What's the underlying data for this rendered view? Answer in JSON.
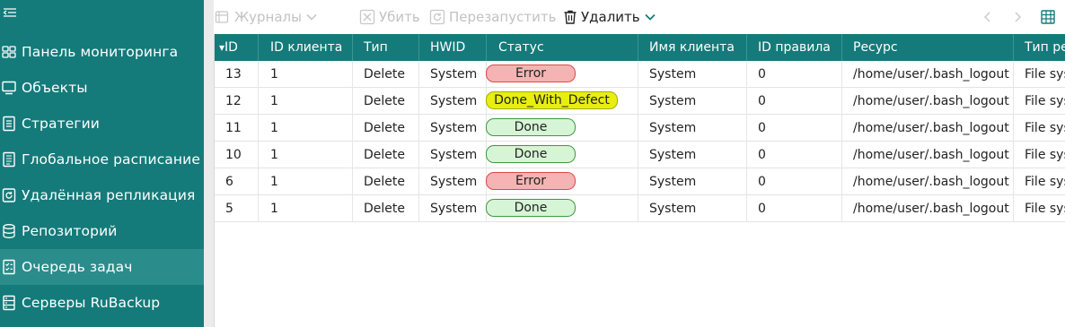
{
  "sidebar": {
    "items": [
      {
        "label": "Панель мониторинга",
        "icon": "dashboard-icon",
        "active": false
      },
      {
        "label": "Объекты",
        "icon": "monitor-icon",
        "active": false
      },
      {
        "label": "Стратегии",
        "icon": "document-icon",
        "active": false
      },
      {
        "label": "Глобальное расписание",
        "icon": "schedule-list-icon",
        "active": false
      },
      {
        "label": "Удалённая репликация",
        "icon": "replication-icon",
        "active": false
      },
      {
        "label": "Репозиторий",
        "icon": "database-icon",
        "active": false
      },
      {
        "label": "Очередь задач",
        "icon": "task-queue-icon",
        "active": true
      },
      {
        "label": "Серверы RuBackup",
        "icon": "server-icon",
        "active": false
      }
    ]
  },
  "toolbar": {
    "journals_label": "Журналы",
    "kill_label": "Убить",
    "restart_label": "Перезапустить",
    "delete_label": "Удалить"
  },
  "table": {
    "sort_indicator": "▾",
    "columns": [
      "ID",
      "ID клиента",
      "Тип",
      "HWID",
      "Статус",
      "Имя клиента",
      "ID правила",
      "Ресурс",
      "Тип ресурса"
    ],
    "rows": [
      {
        "id": "13",
        "client_id": "1",
        "type": "Delete",
        "hwid": "System",
        "status": "Error",
        "client_name": "System",
        "rule_id": "0",
        "resource": "/home/user/.bash_logout",
        "resource_type": "File system"
      },
      {
        "id": "12",
        "client_id": "1",
        "type": "Delete",
        "hwid": "System",
        "status": "Done_With_Defect",
        "client_name": "System",
        "rule_id": "0",
        "resource": "/home/user/.bash_logout",
        "resource_type": "File system"
      },
      {
        "id": "11",
        "client_id": "1",
        "type": "Delete",
        "hwid": "System",
        "status": "Done",
        "client_name": "System",
        "rule_id": "0",
        "resource": "/home/user/.bash_logout",
        "resource_type": "File system"
      },
      {
        "id": "10",
        "client_id": "1",
        "type": "Delete",
        "hwid": "System",
        "status": "Done",
        "client_name": "System",
        "rule_id": "0",
        "resource": "/home/user/.bash_logout",
        "resource_type": "File system"
      },
      {
        "id": "6",
        "client_id": "1",
        "type": "Delete",
        "hwid": "System",
        "status": "Error",
        "client_name": "System",
        "rule_id": "0",
        "resource": "/home/user/.bash_logout",
        "resource_type": "File system"
      },
      {
        "id": "5",
        "client_id": "1",
        "type": "Delete",
        "hwid": "System",
        "status": "Done",
        "client_name": "System",
        "rule_id": "0",
        "resource": "/home/user/.bash_logout",
        "resource_type": "File system"
      }
    ]
  },
  "colors": {
    "sidebar_bg": "#157a7a",
    "sidebar_active": "#2a8d8b",
    "header_bg": "#157a7a",
    "status_error_bg": "#f5b3b3",
    "status_done_bg": "#d6f5d6",
    "status_defect_bg": "#e8ee10"
  }
}
